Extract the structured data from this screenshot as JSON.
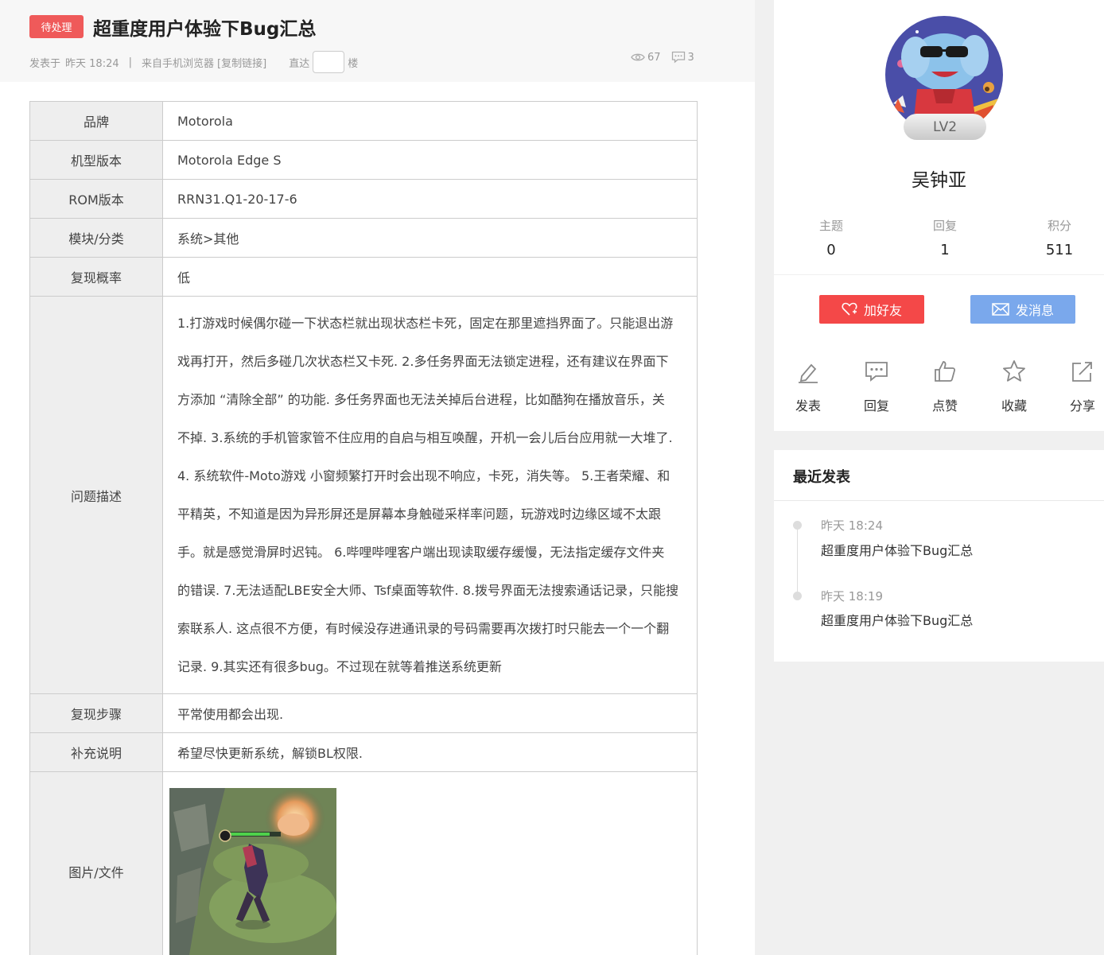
{
  "post": {
    "status_badge": "待处理",
    "title": "超重度用户体验下Bug汇总",
    "meta": {
      "posted_label": "发表于",
      "posted_time": "昨天 18:24",
      "separator": "|",
      "source": "来自手机浏览器",
      "copy_link": "[复制链接]",
      "goto_label": "直达",
      "goto_suffix": "楼"
    },
    "views": "67",
    "replies": "3"
  },
  "info_table": {
    "rows": [
      {
        "label": "品牌",
        "value": "Motorola"
      },
      {
        "label": "机型版本",
        "value": "Motorola Edge S"
      },
      {
        "label": "ROM版本",
        "value": "RRN31.Q1-20-17-6"
      },
      {
        "label": "模块/分类",
        "value": "系统>其他"
      },
      {
        "label": "复现概率",
        "value": "低"
      }
    ],
    "description": {
      "label": "问题描述",
      "lines": [
        "1.打游戏时候偶尔碰一下状态栏就出现状态栏卡死，固定在那里遮挡界面了。只能退出游",
        "戏再打开，然后多碰几次状态栏又卡死. 2.多任务界面无法锁定进程，还有建议在界面下",
        "方添加 “清除全部” 的功能. 多任务界面也无法关掉后台进程，比如酷狗在播放音乐，关",
        "不掉. 3.系统的手机管家管不住应用的自启与相互唤醒，开机一会儿后台应用就一大堆了.",
        "4. 系统软件-Moto游戏 小窗频繁打开时会出现不响应，卡死，消失等。 5.王者荣耀、和",
        "平精英，不知道是因为异形屏还是屏幕本身触碰采样率问题，玩游戏时边缘区域不太跟",
        "手。就是感觉滑屏时迟钝。 6.哔哩哔哩客户端出现读取缓存缓慢，无法指定缓存文件夹",
        "的错误. 7.无法适配LBE安全大师、Tsf桌面等软件. 8.拨号界面无法搜索通话记录，只能搜",
        "索联系人. 这点很不方便，有时候没存进通讯录的号码需要再次拨打时只能去一个一个翻",
        "记录. 9.其实还有很多bug。不过现在就等着推送系统更新"
      ]
    },
    "steps": {
      "label": "复现步骤",
      "value": "平常使用都会出现."
    },
    "notes": {
      "label": "补充说明",
      "value": "希望尽快更新系统，解锁BL权限."
    },
    "attachment": {
      "label": "图片/文件"
    }
  },
  "profile": {
    "level": "LV2",
    "username": "吴钟亚",
    "stats": [
      {
        "label": "主题",
        "value": "0"
      },
      {
        "label": "回复",
        "value": "1"
      },
      {
        "label": "积分",
        "value": "511"
      }
    ],
    "add_friend": "加好友",
    "send_message": "发消息"
  },
  "tools": [
    {
      "label": "发表",
      "icon": "post-icon"
    },
    {
      "label": "回复",
      "icon": "reply-icon"
    },
    {
      "label": "点赞",
      "icon": "like-icon"
    },
    {
      "label": "收藏",
      "icon": "favorite-icon"
    },
    {
      "label": "分享",
      "icon": "share-icon"
    }
  ],
  "recent": {
    "title": "最近发表",
    "items": [
      {
        "time": "昨天 18:24",
        "title": "超重度用户体验下Bug汇总"
      },
      {
        "time": "昨天 18:19",
        "title": "超重度用户体验下Bug汇总"
      }
    ]
  },
  "colors": {
    "badge": "#ef5a5a",
    "add_friend": "#f44848",
    "send_message": "#7aa8ec"
  }
}
